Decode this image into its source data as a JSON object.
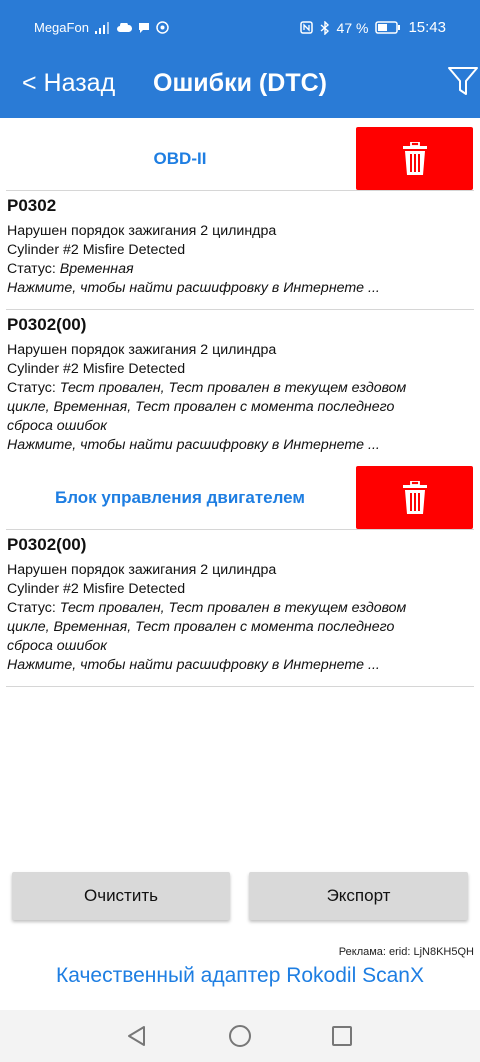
{
  "status_bar": {
    "carrier": "MegaFon",
    "battery": "47 %",
    "time": "15:43"
  },
  "app_bar": {
    "back_label": "< Назад",
    "title": "Ошибки (DTC)"
  },
  "sections": [
    {
      "title": "OBD-II",
      "dtcs": [
        {
          "code": "P0302",
          "desc_ru": "Нарушен порядок зажигания 2 цилиндра",
          "desc_en": "Cylinder #2 Misfire Detected",
          "status_label": "Статус:",
          "status_lines": [
            "Временная"
          ],
          "hint": "Нажмите, чтобы найти расшифровку в Интернете ..."
        },
        {
          "code": "P0302(00)",
          "desc_ru": "Нарушен порядок зажигания 2 цилиндра",
          "desc_en": "Cylinder #2 Misfire Detected",
          "status_label": "Статус:",
          "status_lines": [
            "Тест провален, Тест провален в текущем ездовом",
            "цикле, Временная, Тест провален с момента последнего",
            "сброса ошибок"
          ],
          "hint": "Нажмите, чтобы найти расшифровку в Интернете ..."
        }
      ]
    },
    {
      "title": "Блок управления двигателем",
      "dtcs": [
        {
          "code": "P0302(00)",
          "desc_ru": "Нарушен порядок зажигания 2 цилиндра",
          "desc_en": "Cylinder #2 Misfire Detected",
          "status_label": "Статус:",
          "status_lines": [
            "Тест провален, Тест провален в текущем ездовом",
            "цикле, Временная, Тест провален с момента последнего",
            "сброса ошибок"
          ],
          "hint": "Нажмите, чтобы найти расшифровку в Интернете ..."
        }
      ]
    }
  ],
  "buttons": {
    "clear": "Очистить",
    "export": "Экспорт"
  },
  "ad": {
    "note": "Реклама: erid: LjN8KH5QH",
    "link": "Качественный адаптер Rokodil ScanX"
  },
  "colors": {
    "accent": "#2a7bd6",
    "link": "#1e7ee2",
    "delete": "#ff0000",
    "button_bg": "#d9d9d9"
  },
  "icons": {
    "filter": "filter-icon",
    "delete": "trash-icon",
    "nav_back": "triangle-back-icon",
    "nav_home": "circle-home-icon",
    "nav_recents": "square-recents-icon"
  }
}
